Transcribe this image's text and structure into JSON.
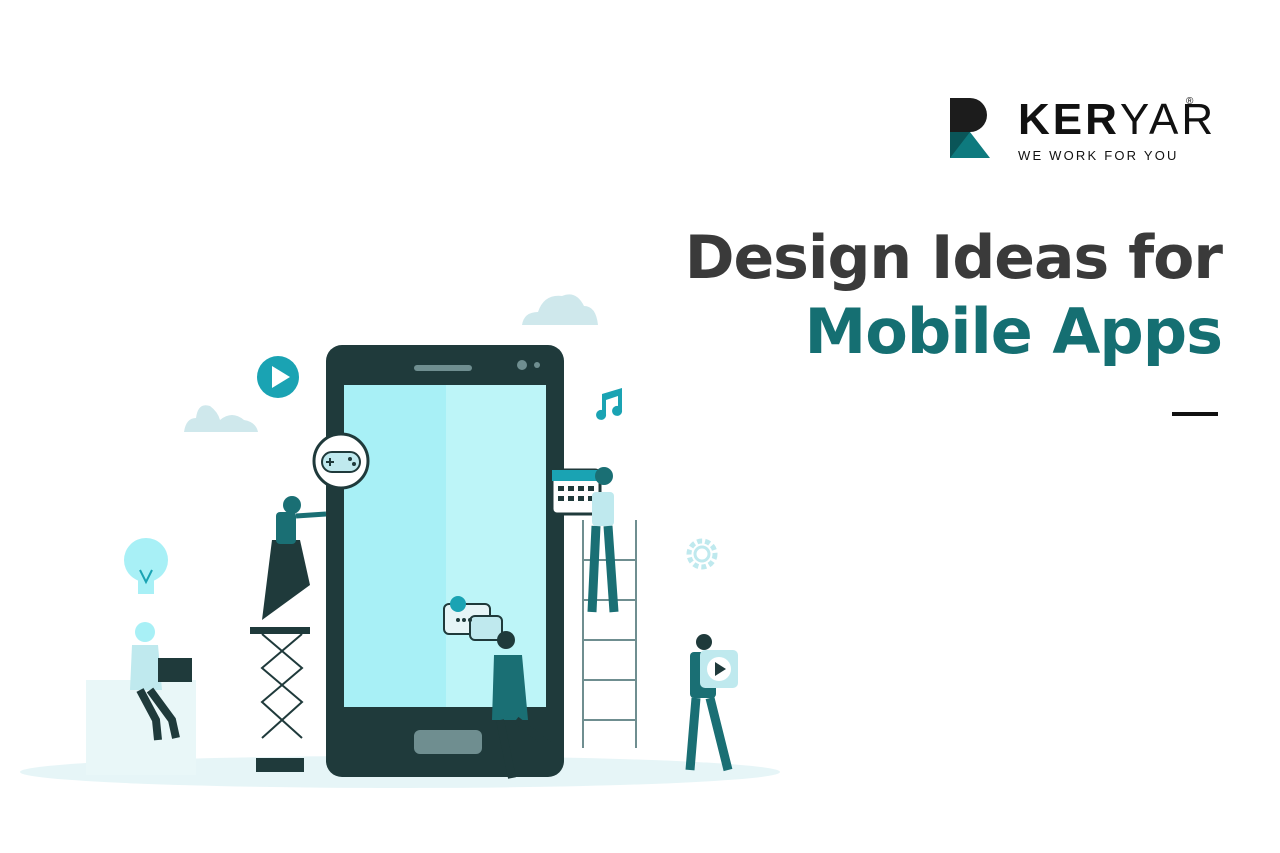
{
  "brand": {
    "name_part1": "KER",
    "name_part2": "YAR",
    "registered_mark": "®",
    "tagline": "WE WORK FOR YOU"
  },
  "headline": {
    "line1": "Design Ideas for",
    "line2": "Mobile Apps"
  },
  "colors": {
    "teal": "#156f72",
    "dark_text": "#3a3a3a",
    "phone_body": "#1f3a3b",
    "phone_screen": "#a8f0f6",
    "light_cyan": "#bfe9ee",
    "accent_cyan": "#1aa3b3"
  },
  "illustration": {
    "icons": [
      "play-icon",
      "gamepad-icon",
      "music-note-icon",
      "calendar-icon",
      "lightbulb-icon",
      "gear-icon",
      "chat-bubble-icon",
      "video-play-icon",
      "cloud-icon"
    ]
  }
}
